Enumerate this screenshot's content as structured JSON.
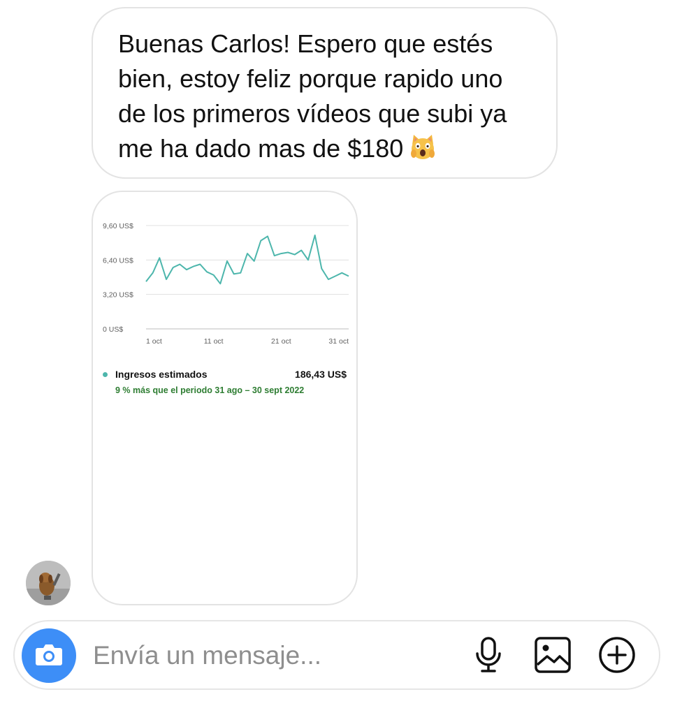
{
  "message": {
    "text_lines": [
      "Buenas Carlos! Espero que estés",
      "bien, estoy feliz porque rapido uno",
      "de los primeros vídeos que subi ya",
      "me ha dado mas de $180"
    ],
    "emoji": "face-screaming-cat"
  },
  "analytics_card": {
    "summary_label": "Ingresos estimados",
    "summary_value": "186,43 US$",
    "comparison_text": "9 % más que el periodo 31 ago – 30 sept 2022",
    "series_color": "#4db6ac",
    "comparison_color": "#2e7d32"
  },
  "chart_data": {
    "type": "line",
    "title": "",
    "xlabel": "",
    "ylabel": "",
    "ylim": [
      0,
      9.6
    ],
    "y_ticks": [
      "0 US$",
      "3,20 US$",
      "6,40 US$",
      "9,60 US$"
    ],
    "y_tick_values": [
      0,
      3.2,
      6.4,
      9.6
    ],
    "x_ticks": [
      "1 oct",
      "11 oct",
      "21 oct",
      "31 oct"
    ],
    "x_tick_days": [
      1,
      11,
      21,
      31
    ],
    "grid": true,
    "series": [
      {
        "x": [
          1,
          2,
          3,
          4,
          5,
          6,
          7,
          8,
          9,
          10,
          11,
          12,
          13,
          14,
          15,
          16,
          17,
          18,
          19,
          20,
          21,
          22,
          23,
          24,
          25,
          26,
          27,
          28,
          29,
          30,
          31
        ],
        "values": [
          4.4,
          5.2,
          6.6,
          4.6,
          5.7,
          6.0,
          5.5,
          5.8,
          6.0,
          5.3,
          5.0,
          4.2,
          6.3,
          5.1,
          5.2,
          7.0,
          6.3,
          8.2,
          8.6,
          6.8,
          7.0,
          7.1,
          6.9,
          7.3,
          6.4,
          8.7,
          5.6,
          4.6,
          4.9,
          5.2,
          4.9
        ]
      }
    ]
  },
  "composer": {
    "placeholder": "Envía un mensaje...",
    "camera_icon": "camera-icon",
    "mic_icon": "microphone-icon",
    "gallery_icon": "image-icon",
    "plus_icon": "plus-circle-icon",
    "camera_color": "#3d8ef7"
  }
}
